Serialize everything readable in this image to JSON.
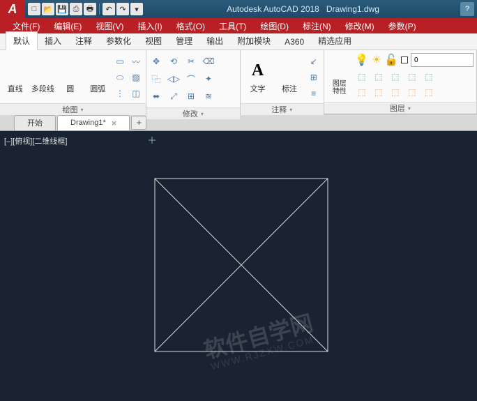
{
  "title": {
    "app": "Autodesk AutoCAD 2018",
    "file": "Drawing1.dwg"
  },
  "menu": [
    "文件(F)",
    "编辑(E)",
    "视图(V)",
    "插入(I)",
    "格式(O)",
    "工具(T)",
    "绘图(D)",
    "标注(N)",
    "修改(M)",
    "参数(P)"
  ],
  "ribbon_tabs": [
    "默认",
    "插入",
    "注释",
    "参数化",
    "视图",
    "管理",
    "输出",
    "附加模块",
    "A360",
    "精选应用"
  ],
  "panels": {
    "draw": {
      "title": "绘图",
      "buttons": [
        "直线",
        "多段线",
        "圆",
        "圆弧"
      ]
    },
    "modify": {
      "title": "修改"
    },
    "annotate": {
      "title": "注释",
      "buttons": [
        "文字",
        "标注"
      ]
    },
    "layer": {
      "title": "图层",
      "button": "图层\n特性",
      "combo": "0"
    }
  },
  "doc_tabs": {
    "start": "开始",
    "active": "Drawing1*"
  },
  "view_label": "[–][俯视][二维线框]",
  "watermark": {
    "main": "软件自学网",
    "sub": "WWW.RJZXW.COM"
  }
}
